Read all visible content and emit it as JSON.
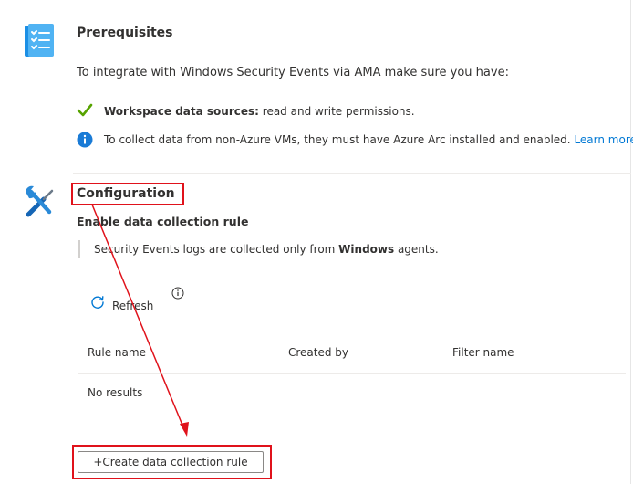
{
  "prerequisites": {
    "title": "Prerequisites",
    "intro": "To integrate with Windows Security Events via AMA make sure you have:",
    "workspace_label": "Workspace data sources:",
    "workspace_text": " read and write permissions.",
    "info_text": "To collect data from non-Azure VMs, they must have Azure Arc installed and enabled.",
    "learn_more": "Learn more"
  },
  "configuration": {
    "title": "Configuration",
    "subtitle": "Enable data collection rule",
    "note_prefix": "Security Events logs are collected only from ",
    "note_bold": "Windows",
    "note_suffix": " agents.",
    "refresh_label": "Refresh",
    "table": {
      "columns": [
        "Rule name",
        "Created by",
        "Filter name"
      ],
      "empty_text": "No results"
    },
    "create_button": "+Create data collection rule"
  },
  "colors": {
    "accent": "#0078d4",
    "success": "#57a300",
    "annotation_red": "#e0121b"
  },
  "icons": {
    "prerequisites": "checklist-icon",
    "configuration": "tools-icon",
    "check": "checkmark-icon",
    "info": "info-icon",
    "refresh": "refresh-icon",
    "tooltip": "info-outline-icon"
  }
}
